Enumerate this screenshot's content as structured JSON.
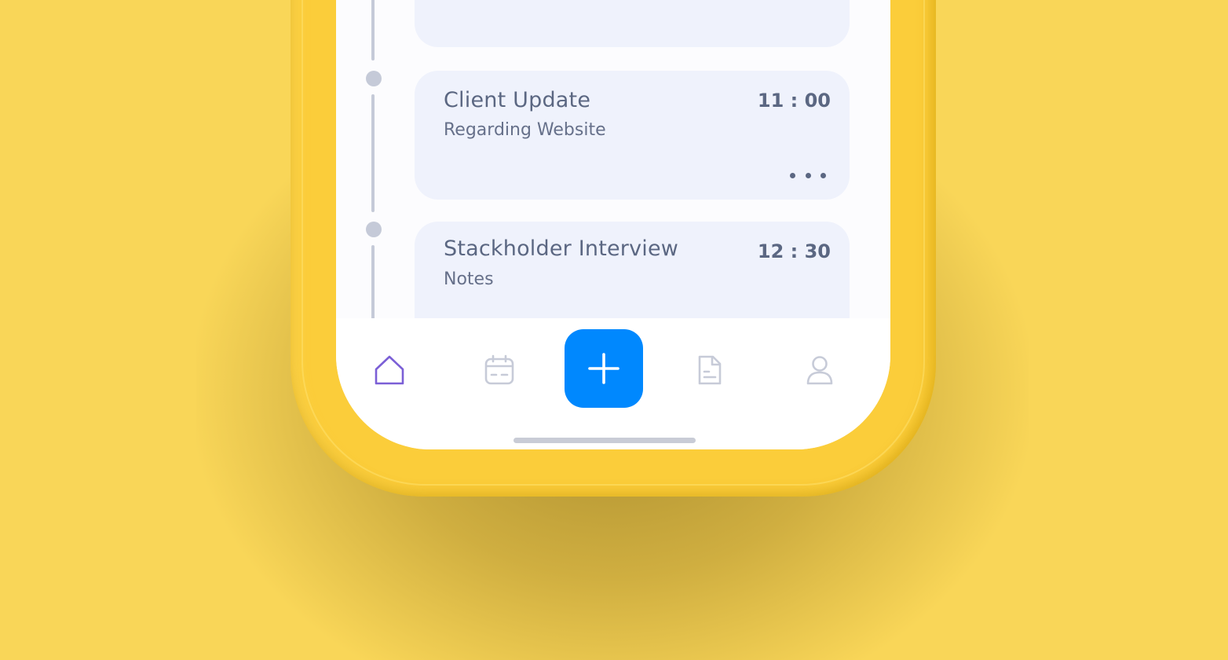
{
  "schedule": {
    "cards": [
      {
        "title": "",
        "subtitle": "",
        "time": ""
      },
      {
        "title": "Client Update",
        "subtitle": "Regarding Website",
        "time": "11 : 00"
      },
      {
        "title": "Stackholder Interview",
        "subtitle": "Notes",
        "time": "12 : 30"
      }
    ]
  },
  "tabbar": {
    "tabs": [
      {
        "name": "home",
        "icon": "home-icon",
        "active": true
      },
      {
        "name": "calendar",
        "icon": "calendar-icon",
        "active": false
      },
      {
        "name": "add",
        "icon": "plus-icon",
        "active": false
      },
      {
        "name": "documents",
        "icon": "document-icon",
        "active": false
      },
      {
        "name": "profile",
        "icon": "user-icon",
        "active": false
      }
    ]
  },
  "colors": {
    "background": "#f9d658",
    "phone_frame": "#fbcd3a",
    "card_bg": "#eff2fc",
    "text": "#5b6782",
    "accent_blue": "#0088fe",
    "active_icon": "#7b5fd6",
    "inactive_icon": "#c7cbd8"
  }
}
